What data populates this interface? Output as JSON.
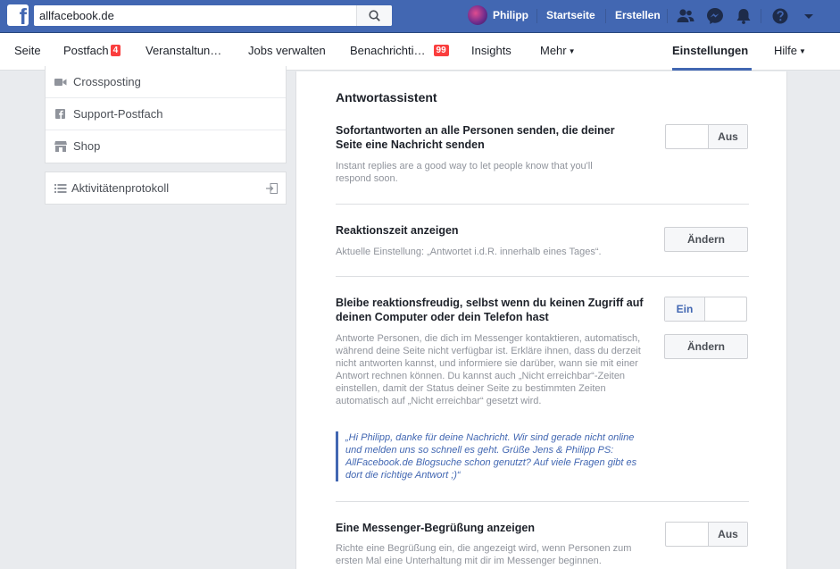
{
  "topbar": {
    "search_value": "allfacebook.de",
    "user_name": "Philipp",
    "links": [
      "Startseite",
      "Erstellen"
    ],
    "icons": [
      "friends-icon",
      "messenger-icon",
      "notifications-icon",
      "help-icon",
      "account-menu-icon"
    ]
  },
  "pagenav": {
    "items": [
      {
        "label": "Seite"
      },
      {
        "label": "Postfach",
        "badge": "4"
      },
      {
        "label": "Veranstaltun…"
      },
      {
        "label": "Jobs verwalten"
      },
      {
        "label": "Benachrichti…",
        "badge": "99"
      },
      {
        "label": "Insights"
      },
      {
        "label": "Mehr"
      },
      {
        "label": "Einstellungen"
      },
      {
        "label": "Hilfe"
      }
    ],
    "active": "Einstellungen"
  },
  "sidebar": {
    "items": [
      {
        "label": "Crossposting",
        "icon": "video-camera-icon"
      },
      {
        "label": "Support-Postfach",
        "icon": "facebook-square-icon"
      },
      {
        "label": "Shop",
        "icon": "shop-icon"
      }
    ],
    "activity": {
      "label": "Aktivitätenprotokoll",
      "icon": "list-icon",
      "action_icon": "export-icon"
    }
  },
  "main": {
    "title": "Antwortassistent",
    "rows": [
      {
        "title": "Sofortantworten an alle Personen senden, die deiner Seite eine Nachricht senden",
        "description": "Instant replies are a good way to let people know that you'll respond soon.",
        "toggle": "Aus"
      },
      {
        "title": "Reaktionszeit anzeigen",
        "description": "Aktuelle Einstellung: „Antwortet i.d.R. innerhalb eines Tages“.",
        "button": "Ändern"
      },
      {
        "title": "Bleibe reaktionsfreudig, selbst wenn du keinen Zugriff auf deinen Computer oder dein Telefon hast",
        "description": "Antworte Personen, die dich im Messenger kontaktieren, automatisch, während deine Seite nicht verfügbar ist. Erkläre ihnen, dass du derzeit nicht antworten kannst, und informiere sie darüber, wann sie mit einer Antwort rechnen können. Du kannst auch „Nicht erreichbar“-Zeiten einstellen, damit der Status deiner Seite zu bestimmten Zeiten automatisch auf „Nicht erreichbar“ gesetzt wird.",
        "toggle": "Ein",
        "button": "Ändern",
        "quote": "„Hi Philipp, danke für deine Nachricht. Wir sind gerade nicht online und melden uns so schnell es geht. Grüße Jens & Philipp PS: AllFacebook.de Blogsuche schon genutzt? Auf viele Fragen gibt es dort die richtige Antwort ;)“"
      },
      {
        "title": "Eine Messenger-Begrüßung anzeigen",
        "description": "Richte eine Begrüßung ein, die angezeigt wird, wenn Personen zum ersten Mal eine Unterhaltung mit dir im Messenger beginnen.",
        "toggle": "Aus"
      }
    ]
  },
  "colors": {
    "brand": "#4267b2",
    "badge": "#fa3e3e",
    "page_bg": "#e9ebee"
  }
}
